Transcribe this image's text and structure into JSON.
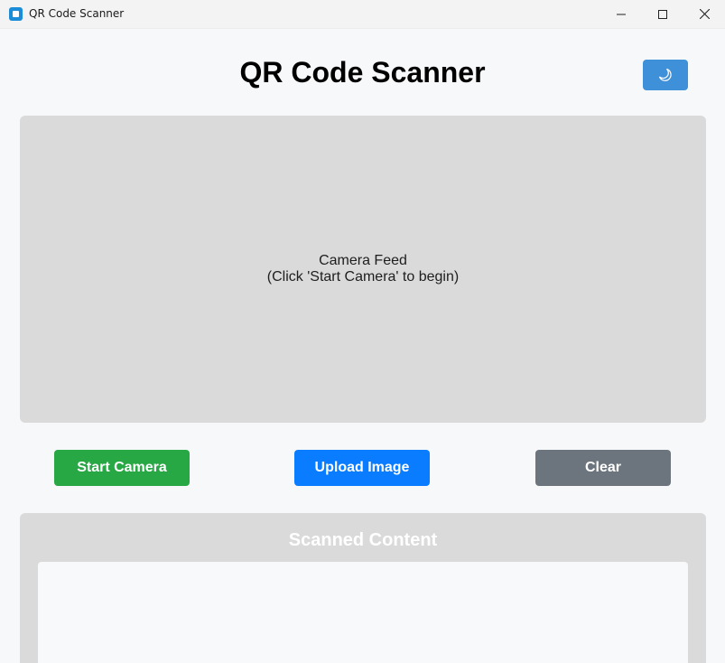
{
  "window": {
    "title": "QR Code Scanner",
    "controls": [
      "minimize-icon",
      "maximize-icon",
      "close-icon"
    ]
  },
  "header": {
    "title": "QR Code Scanner",
    "theme_toggle_icon": "moon-icon"
  },
  "camera": {
    "line1": "Camera Feed",
    "line2": "(Click 'Start Camera' to begin)"
  },
  "actions": {
    "start_label": "Start Camera",
    "upload_label": "Upload Image",
    "clear_label": "Clear"
  },
  "results": {
    "title": "Scanned Content",
    "content": ""
  },
  "colors": {
    "start": "#28a745",
    "upload": "#0a7cff",
    "clear": "#6c757d",
    "theme_button": "#3e90d8",
    "panel": "#dadada",
    "background": "#f7f8fa"
  }
}
